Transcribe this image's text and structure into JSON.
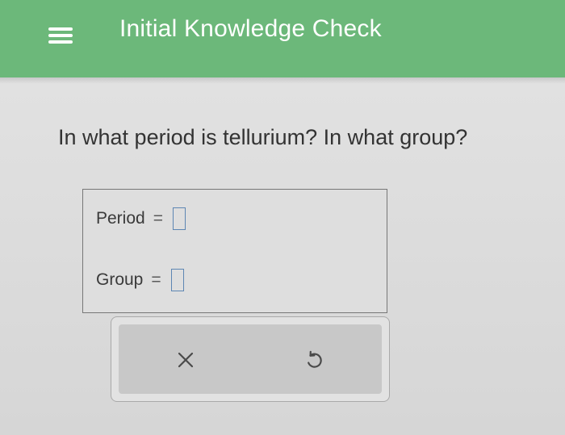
{
  "header": {
    "title": "Initial Knowledge Check",
    "menu_icon": "hamburger-menu-icon",
    "background_color": "#6cb87a"
  },
  "question": {
    "text": "In what period is tellurium? In what group?"
  },
  "answer": {
    "period_label": "Period",
    "group_label": "Group",
    "equals": "=",
    "period_value": "",
    "group_value": ""
  },
  "controls": {
    "clear_icon": "x-icon",
    "undo_icon": "undo-icon"
  }
}
